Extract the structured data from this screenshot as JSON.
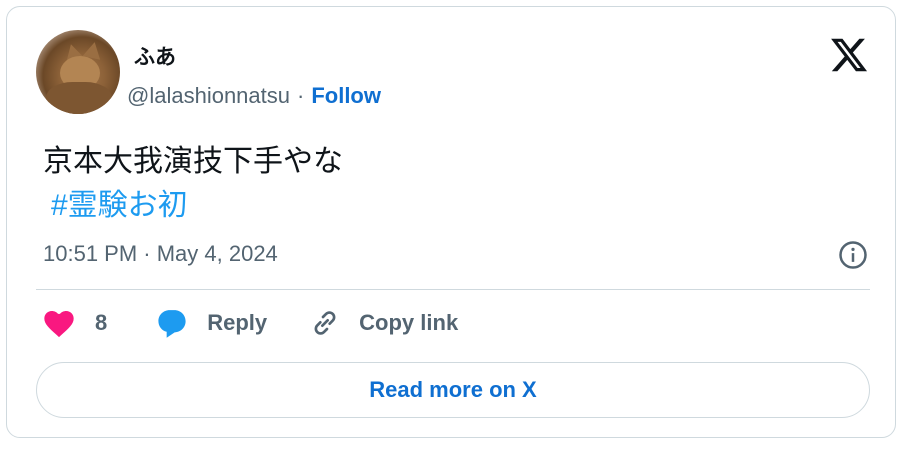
{
  "author": {
    "display_name": "ふあ",
    "handle": "@lalashionnatsu",
    "separator": "·",
    "follow_label": "Follow"
  },
  "tweet": {
    "text": "京本大我演技下手やな",
    "hashtag": "#霊験お初",
    "timestamp": "10:51 PM · May 4, 2024"
  },
  "actions": {
    "like_count": "8",
    "reply_label": "Reply",
    "copy_link_label": "Copy link"
  },
  "footer": {
    "read_more_label": "Read more on X"
  },
  "colors": {
    "accent": "#0f6fd1",
    "hashtag": "#1d9bf0",
    "like": "#f91880",
    "reply": "#1d9bf0",
    "secondary_text": "#536471",
    "border": "#cfd9de"
  },
  "icons": [
    "x-logo-icon",
    "info-icon",
    "heart-icon",
    "reply-bubble-icon",
    "link-icon"
  ]
}
